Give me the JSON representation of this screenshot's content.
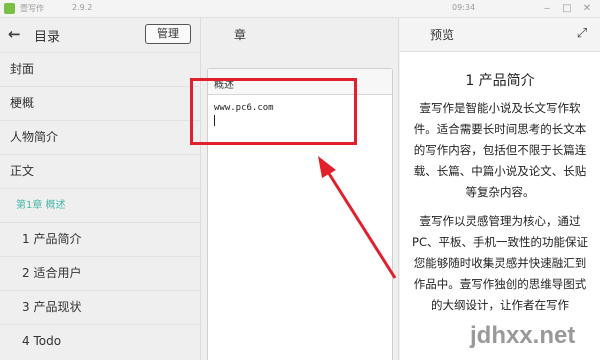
{
  "window": {
    "app_title": "壹写作",
    "version": "2.9.2",
    "clock": "09:34",
    "controls": [
      "‒",
      "□",
      "✕"
    ]
  },
  "sidebar": {
    "back_icon": "back-arrow-icon",
    "title": "目录",
    "manage_label": "管理",
    "items": [
      {
        "label": "封面",
        "level": 0
      },
      {
        "label": "梗概",
        "level": 0
      },
      {
        "label": "人物简介",
        "level": 0
      },
      {
        "label": "正文",
        "level": 0
      },
      {
        "label": "第1章 概述",
        "level": 1
      },
      {
        "label": "1 产品简介",
        "level": 2
      },
      {
        "label": "2 适合用户",
        "level": 2
      },
      {
        "label": "3 产品现状",
        "level": 2
      },
      {
        "label": "4 Todo",
        "level": 2
      }
    ]
  },
  "chapter": {
    "title": "章",
    "card_title": "概述",
    "card_text": "www.pc6.com"
  },
  "preview": {
    "label": "预览",
    "expand_icon": "expand-icon",
    "heading": "1 产品简介",
    "paragraphs": [
      "壹写作是智能小说及长文写作软件。适合需要长时间思考的长文本的写作内容，包括但不限于长篇连载、长篇、中篇小说及论文、长贴等复杂内容。",
      "壹写作以灵感管理为核心，通过PC、平板、手机一致性的功能保证您能够随时收集灵感并快速融汇到作品中。壹写作独创的思维导图式的大纲设计，让作者在写作"
    ]
  },
  "annotation": {
    "color": "#e0202a"
  },
  "watermark": "jdhxx.net"
}
